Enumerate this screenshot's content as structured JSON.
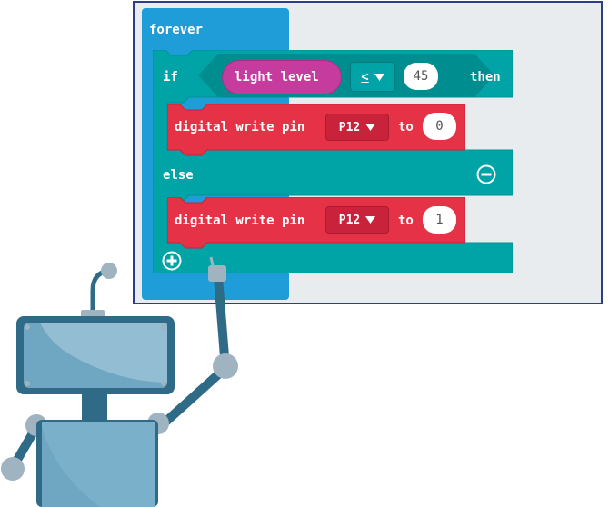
{
  "blocks": {
    "forever_label": "forever",
    "if_label": "if",
    "light_level_label": "light level",
    "operator": "<",
    "threshold": "45",
    "then_label": "then",
    "digital_write_label": "digital write pin",
    "to_label": "to",
    "pin_1": "P12",
    "value_1": "0",
    "else_label": "else",
    "pin_2": "P12",
    "value_2": "1"
  },
  "colors": {
    "forever": "#1e9dd8",
    "if_block": "#00a4a6",
    "pin_block": "#e63247",
    "light_level": "#c63c9e"
  },
  "icons": {
    "remove": "minus-circle-icon",
    "add": "plus-circle-icon",
    "dropdown": "caret-down-icon"
  }
}
